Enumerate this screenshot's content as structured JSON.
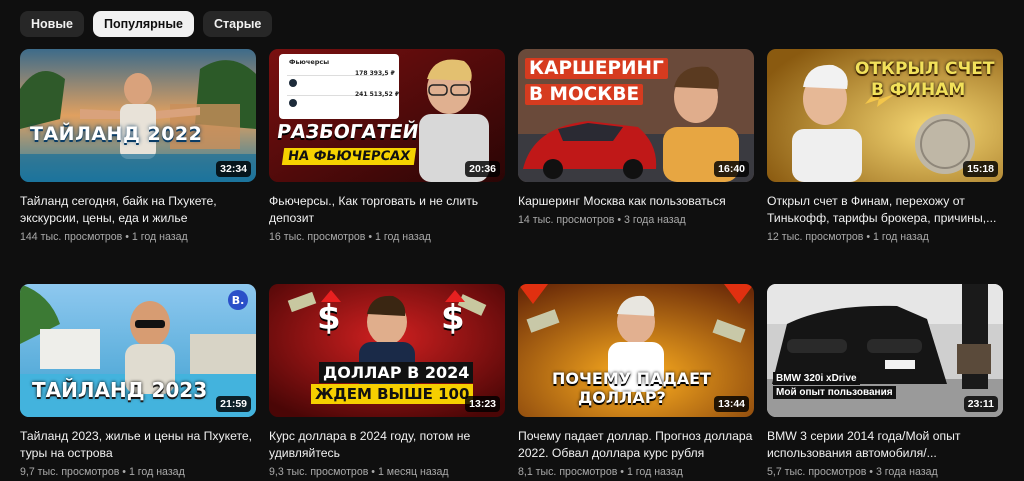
{
  "filters": {
    "new": "Новые",
    "popular": "Популярные",
    "old": "Старые",
    "active": "popular"
  },
  "videos": [
    {
      "title": "Тайланд сегодня, байк на Пхукете, экскурсии, цены, еда и жилье",
      "views": "144 тыс. просмотров",
      "age": "1 год назад",
      "duration": "32:34",
      "thumb_text": [
        "ТАЙЛАНД 2022"
      ]
    },
    {
      "title": "Фьючерсы., Как торговать и не слить депозит",
      "views": "16 тыс. просмотров",
      "age": "1 год назад",
      "duration": "20:36",
      "thumb_text": [
        "РАЗБОГАТЕЙ",
        "НА ФЬЮЧЕРСАХ",
        "Фьючерсы",
        "178 393,5 ₽",
        "241 513,52 ₽"
      ]
    },
    {
      "title": "Каршеринг Москва как пользоваться",
      "views": "14 тыс. просмотров",
      "age": "3 года назад",
      "duration": "16:40",
      "thumb_text": [
        "КАРШЕРИНГ",
        "В МОСКВЕ"
      ]
    },
    {
      "title": "Открыл счет в Финам, перехожу от Тинькофф, тарифы брокера, причины,...",
      "views": "12 тыс. просмотров",
      "age": "1 год назад",
      "duration": "15:18",
      "thumb_text": [
        "ОТКРЫЛ СЧЕТ",
        "В ФИНАМ"
      ]
    },
    {
      "title": "Тайланд 2023, жилье и цены на Пхукете, туры на острова",
      "views": "9,7 тыс. просмотров",
      "age": "1 год назад",
      "duration": "21:59",
      "thumb_text": [
        "ТАЙЛАНД 2023",
        "B."
      ]
    },
    {
      "title": "Курс доллара в 2024 году, потом не удивляйтесь",
      "views": "9,3 тыс. просмотров",
      "age": "1 месяц назад",
      "duration": "13:23",
      "thumb_text": [
        "ДОЛЛАР В 2024",
        "ЖДЕМ ВЫШЕ 100",
        "$",
        "$"
      ]
    },
    {
      "title": "Почему падает доллар. Прогноз доллара 2022. Обвал доллара курс рубля",
      "views": "8,1 тыс. просмотров",
      "age": "1 год назад",
      "duration": "13:44",
      "thumb_text": [
        "ПОЧЕМУ ПАДАЕТ",
        "ДОЛЛАР?"
      ]
    },
    {
      "title": "BMW 3 серии 2014 года/Мой опыт использования автомобиля/...",
      "views": "5,7 тыс. просмотров",
      "age": "3 года назад",
      "duration": "23:11",
      "thumb_text": [
        "BMW 320i xDrive",
        "Мой опыт пользования"
      ]
    }
  ]
}
